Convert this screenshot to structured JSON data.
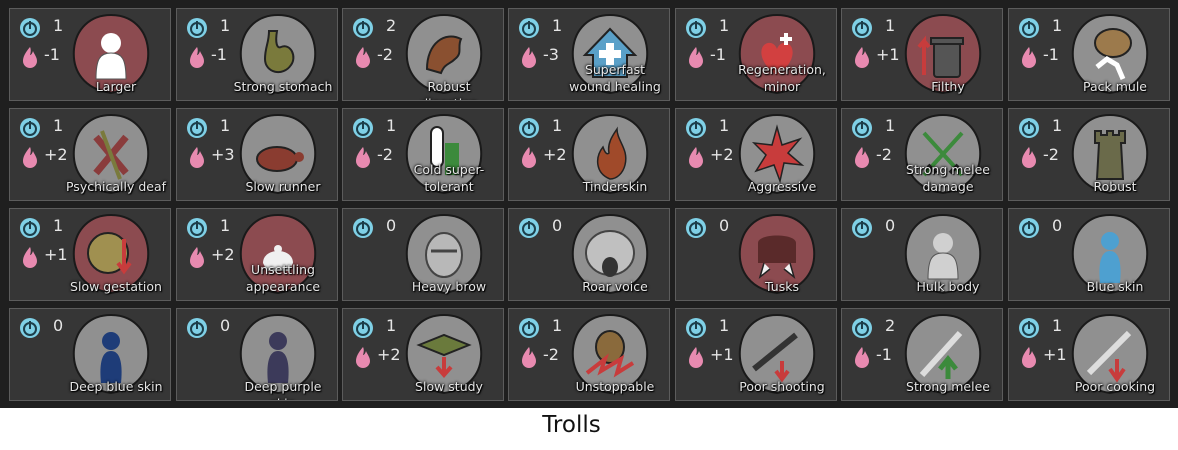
{
  "caption": "Trolls",
  "genes": [
    {
      "label": "Larger",
      "complexity": "1",
      "metabolism": "-1",
      "icon": "body-silhouette-icon",
      "bg": "#8c4b50",
      "fg": "#ffffff"
    },
    {
      "label": "Strong stomach",
      "complexity": "1",
      "metabolism": "-1",
      "icon": "stomach-icon",
      "bg": "#909090",
      "fg": "#7a7a3c"
    },
    {
      "label": "Robust digestion",
      "complexity": "2",
      "metabolism": "-2",
      "icon": "digestion-icon",
      "bg": "#909090",
      "fg": "#8a5030"
    },
    {
      "label": "Superfast wound healing",
      "complexity": "1",
      "metabolism": "-3",
      "icon": "healing-house-icon",
      "bg": "#909090",
      "fg": "#5aa0c8"
    },
    {
      "label": "Regeneration, minor",
      "complexity": "1",
      "metabolism": "-1",
      "icon": "heart-plus-icon",
      "bg": "#8c4b50",
      "fg": "#d24040"
    },
    {
      "label": "Filthy",
      "complexity": "1",
      "metabolism": "+1",
      "icon": "trash-can-icon",
      "bg": "#8c4b50",
      "fg": "#555555"
    },
    {
      "label": "Pack mule",
      "complexity": "1",
      "metabolism": "-1",
      "icon": "pack-mule-icon",
      "bg": "#909090",
      "fg": "#9c7a4c"
    },
    {
      "label": "Psychically deaf",
      "complexity": "1",
      "metabolism": "+2",
      "icon": "crossed-out-icon",
      "bg": "#909090",
      "fg": "#8a3c3c"
    },
    {
      "label": "Slow runner",
      "complexity": "1",
      "metabolism": "+3",
      "icon": "turtle-icon",
      "bg": "#909090",
      "fg": "#8a3c30"
    },
    {
      "label": "Cold super-tolerant",
      "complexity": "1",
      "metabolism": "-2",
      "icon": "thermometer-icon",
      "bg": "#909090",
      "fg": "#3c8a3c"
    },
    {
      "label": "Tinderskin",
      "complexity": "1",
      "metabolism": "+2",
      "icon": "flame-icon",
      "bg": "#909090",
      "fg": "#a04a2a"
    },
    {
      "label": "Aggressive",
      "complexity": "1",
      "metabolism": "+2",
      "icon": "burst-icon",
      "bg": "#909090",
      "fg": "#c83c3c"
    },
    {
      "label": "Strong melee damage",
      "complexity": "1",
      "metabolism": "-2",
      "icon": "crossed-swords-icon",
      "bg": "#909090",
      "fg": "#3c8a3c"
    },
    {
      "label": "Robust",
      "complexity": "1",
      "metabolism": "-2",
      "icon": "tower-icon",
      "bg": "#909090",
      "fg": "#6a6a4a"
    },
    {
      "label": "Slow gestation",
      "complexity": "1",
      "metabolism": "+1",
      "icon": "fetus-icon",
      "bg": "#8c4b50",
      "fg": "#a09050"
    },
    {
      "label": "Unsettling appearance",
      "complexity": "1",
      "metabolism": "+2",
      "icon": "eerie-face-icon",
      "bg": "#8c4b50",
      "fg": "#f0f0f0"
    },
    {
      "label": "Heavy brow",
      "complexity": "0",
      "metabolism": "",
      "icon": "face-brow-icon",
      "bg": "#909090",
      "fg": "#b8b8b8"
    },
    {
      "label": "Roar voice",
      "complexity": "0",
      "metabolism": "",
      "icon": "roaring-head-icon",
      "bg": "#909090",
      "fg": "#c0c0c0"
    },
    {
      "label": "Tusks",
      "complexity": "0",
      "metabolism": "",
      "icon": "tusks-icon",
      "bg": "#8c4b50",
      "fg": "#f0f0f0"
    },
    {
      "label": "Hulk body",
      "complexity": "0",
      "metabolism": "",
      "icon": "hulk-body-icon",
      "bg": "#909090",
      "fg": "#d0d0d0"
    },
    {
      "label": "Blue skin",
      "complexity": "0",
      "metabolism": "",
      "icon": "blue-figure-icon",
      "bg": "#909090",
      "fg": "#4ea0d0"
    },
    {
      "label": "Deep blue skin",
      "complexity": "0",
      "metabolism": "",
      "icon": "deep-blue-figure-icon",
      "bg": "#909090",
      "fg": "#1e3c78"
    },
    {
      "label": "Deep purple skin",
      "complexity": "0",
      "metabolism": "",
      "icon": "purple-figure-icon",
      "bg": "#909090",
      "fg": "#3c3a5a"
    },
    {
      "label": "Slow study",
      "complexity": "1",
      "metabolism": "+2",
      "icon": "graduation-cap-icon",
      "bg": "#909090",
      "fg": "#6a7a3c"
    },
    {
      "label": "Unstoppable",
      "complexity": "1",
      "metabolism": "-2",
      "icon": "unstoppable-icon",
      "bg": "#909090",
      "fg": "#8a6a3c"
    },
    {
      "label": "Poor shooting",
      "complexity": "1",
      "metabolism": "+1",
      "icon": "rifle-down-icon",
      "bg": "#909090",
      "fg": "#c83c3c"
    },
    {
      "label": "Strong melee",
      "complexity": "2",
      "metabolism": "-1",
      "icon": "sword-up-icon",
      "bg": "#909090",
      "fg": "#3c8a3c"
    },
    {
      "label": "Poor cooking",
      "complexity": "1",
      "metabolism": "+1",
      "icon": "cooking-down-icon",
      "bg": "#909090",
      "fg": "#c83c3c"
    }
  ]
}
